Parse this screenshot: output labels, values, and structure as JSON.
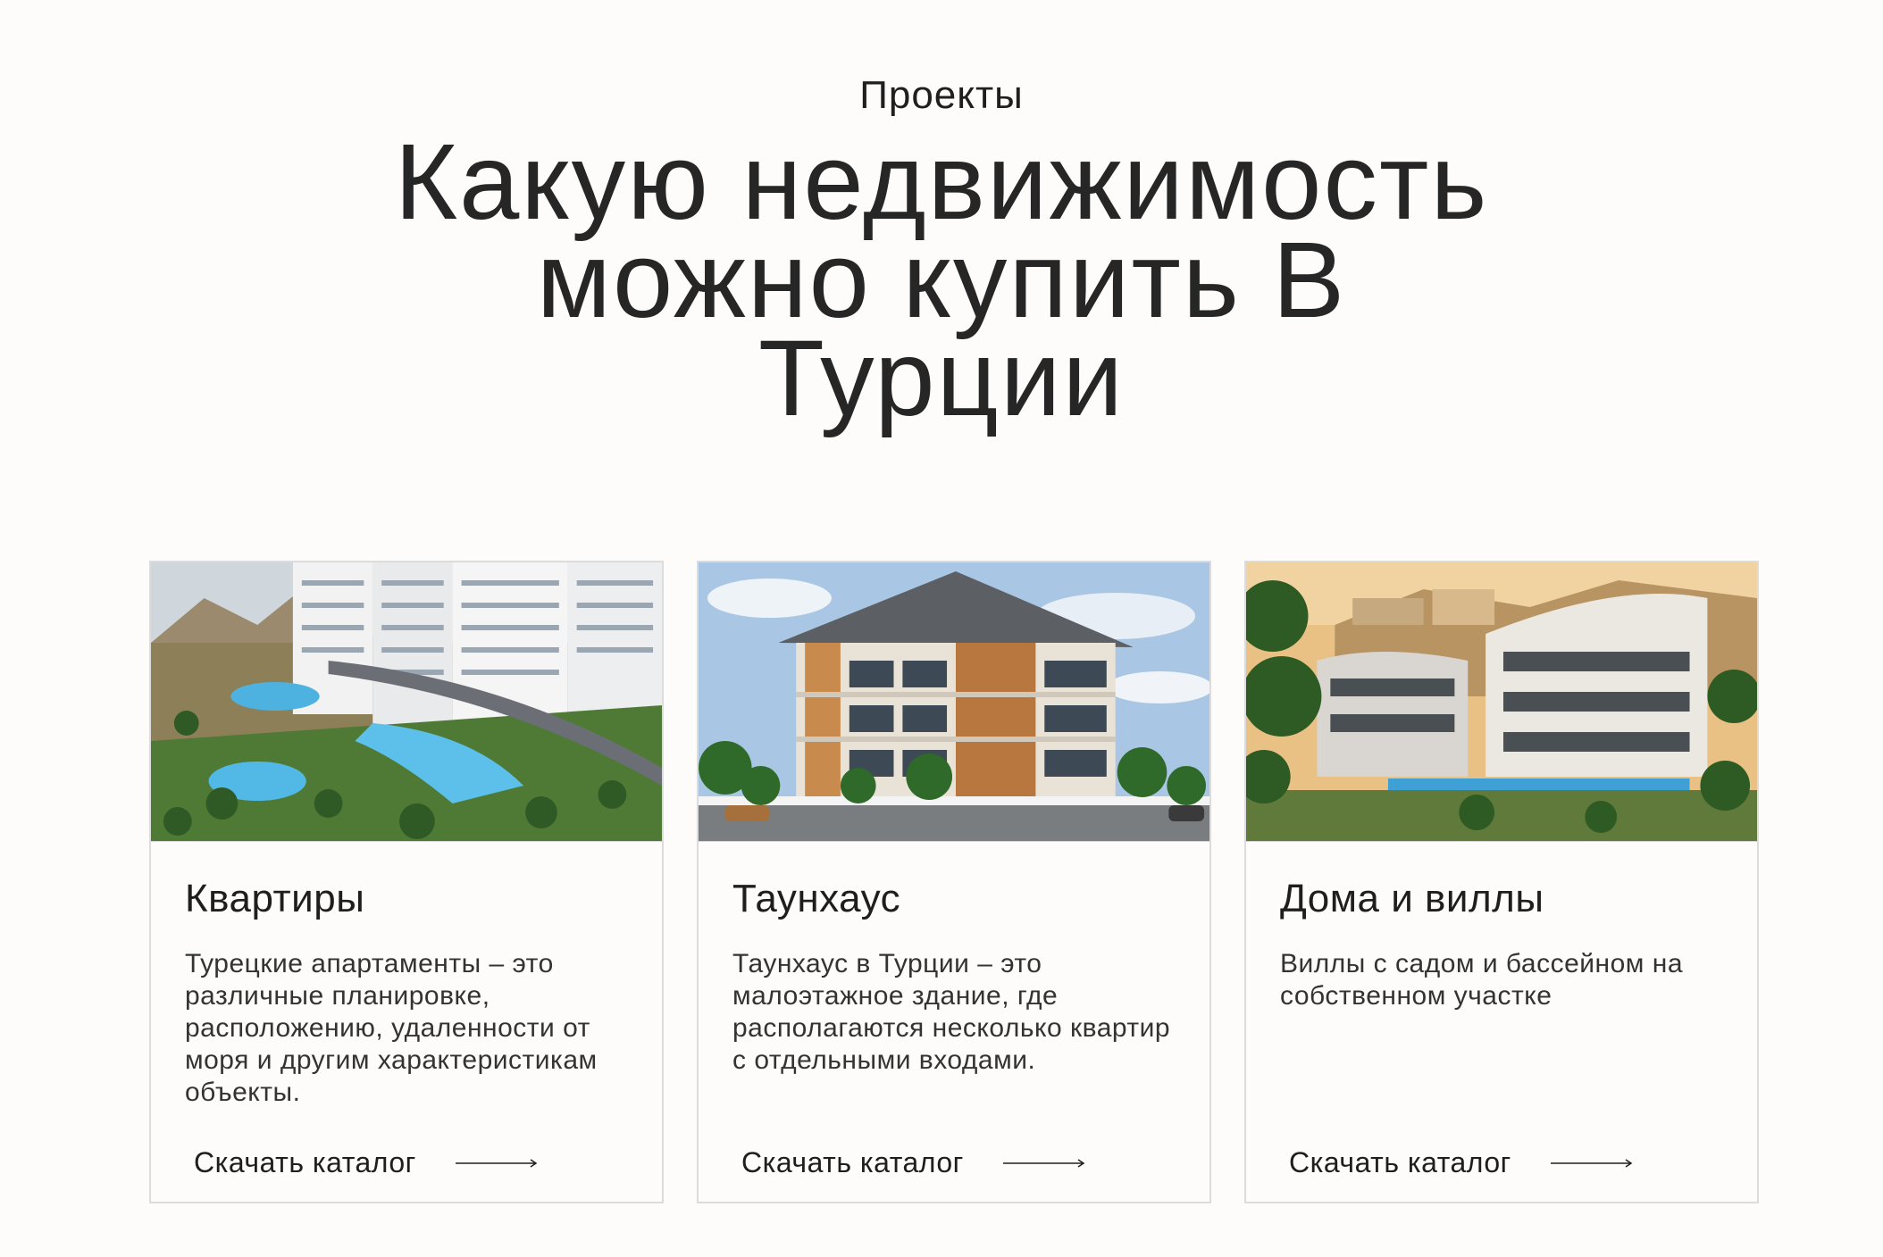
{
  "section": {
    "label": "Проекты",
    "title_lines": [
      "Какую недвижимость",
      "можно купить В",
      "Турции"
    ]
  },
  "cards": [
    {
      "title": "Квартиры",
      "text": "Турецкие апартаменты – это различные планировке, расположению, удаленности от моря и другим характеристикам объекты.",
      "cta": "Скачать каталог",
      "image": "apartment-complex-photo"
    },
    {
      "title": "Таунхаус",
      "text": "Таунхаус в Турции – это малоэтажное здание, где располагаются несколько квартир с отдельными входами.",
      "cta": "Скачать каталог",
      "image": "townhouse-photo"
    },
    {
      "title": "Дома и виллы",
      "text": "Виллы с садом и бассейном на собственном участке",
      "cta": "Скачать каталог",
      "image": "villa-photo"
    }
  ],
  "colors": {
    "background": "#fdfcfb",
    "text": "#1f1f1f",
    "card_border": "#dcdcdc"
  }
}
